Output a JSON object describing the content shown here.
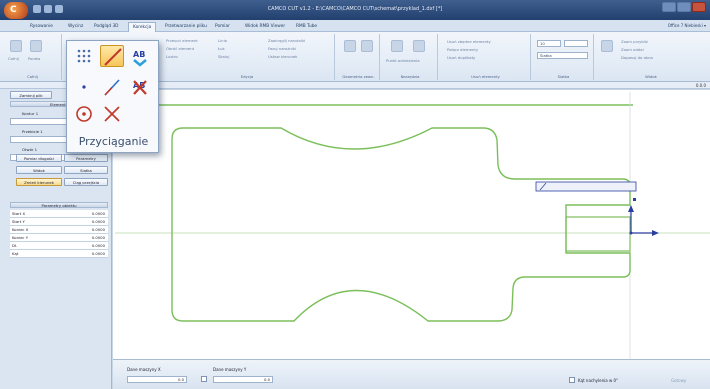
{
  "window": {
    "title": "CAMCO CUT v1.2 - E:\\CAMCO\\CAMCO CUT\\schemat\\przyklad_1.dxf [*]",
    "app_orb_label": "C"
  },
  "ribbon_tabs": [
    {
      "label": "Rysowanie"
    },
    {
      "label": "Wycinz"
    },
    {
      "label": "Podgląd 3D"
    },
    {
      "label": "Korekcja"
    },
    {
      "label": "Przetwarzanie pliku"
    },
    {
      "label": "Pomiar"
    },
    {
      "label": "Widok RMB Viewer"
    },
    {
      "label": "RMB Tube"
    }
  ],
  "active_tab": "Korekcja",
  "style_selector": "Office 7 Niebieski ▾",
  "ribbon": {
    "groups": [
      {
        "label": "Cofnij"
      },
      {
        "label": "Edycja"
      },
      {
        "label": "Geometria zewn."
      },
      {
        "label": "Narzędzia"
      },
      {
        "label": "Usuń elementy"
      },
      {
        "label": "Siatka"
      },
      {
        "label": "Widok"
      }
    ],
    "items": {
      "g1": [
        "Cofnij",
        "Ponów"
      ],
      "g2": [
        "Przesuń element",
        "Obróć element",
        "Lustro",
        "Linia",
        "Łuk",
        "Skaluj"
      ],
      "g3": [
        "Zaokrąglij narożniki",
        "Fazuj narożniki",
        "Ustaw kierunek",
        "Zmień start/koniec"
      ],
      "g4": [
        "Punkt odniesienia",
        "Przecięcia",
        "Wymiarowanie"
      ],
      "g5": [
        "Usuń zbędne elementy",
        "Połącz elementy",
        "Usuń duplikaty"
      ],
      "grid_combo_value": "10",
      "grid_combo2_value": "Siatka",
      "view": [
        "Zoom przybliż",
        "Zoom oddal",
        "Dopasuj do okna"
      ]
    }
  },
  "status_coords": "0.0.0",
  "left_panel": {
    "top_button": "Zamknij plik",
    "section_header": "Elementy",
    "label_1": "Kontur 1",
    "label_2": "Przebicie 1",
    "label_3": "Otwór 1",
    "button_grid": [
      {
        "label": "Pomiar długości",
        "selected": false
      },
      {
        "label": "Parametry",
        "selected": false
      },
      {
        "label": "Widok",
        "selected": false
      },
      {
        "label": "Siatka",
        "selected": false
      },
      {
        "label": "Zmień kierunek",
        "selected": true
      },
      {
        "label": "Ciąg przejścia",
        "selected": false
      }
    ],
    "properties_header": "Parametry obiektu",
    "properties": [
      {
        "key": "Start X",
        "value": "0.0000"
      },
      {
        "key": "Start Y",
        "value": "0.0000"
      },
      {
        "key": "Koniec X",
        "value": "0.0000"
      },
      {
        "key": "Koniec Y",
        "value": "0.0000"
      },
      {
        "key": "Dł.",
        "value": "0.0000"
      },
      {
        "key": "Kąt",
        "value": "0.0000"
      }
    ]
  },
  "snap_popup": {
    "label": "Przyciąganie",
    "tools": [
      {
        "icon": "grid-points-icon",
        "active": false
      },
      {
        "icon": "line-end-icon",
        "active": true
      },
      {
        "icon": "tangent-icon",
        "active": false
      },
      {
        "icon": "point-icon",
        "active": false
      },
      {
        "icon": "midpoint-line-icon",
        "active": false
      },
      {
        "icon": "intersection-icon",
        "active": false
      },
      {
        "icon": "center-icon",
        "active": false
      },
      {
        "icon": "cross-icon",
        "active": false
      }
    ]
  },
  "bottom_bar": {
    "field1_label": "Dane maszyny X",
    "field1_value": "0.0",
    "field2_label": "Dane maszyny Y",
    "field2_value": "0.0",
    "checkbox_label": "Kąt nachylenia w 0°",
    "corner_text": "Gotowy"
  },
  "colors": {
    "contour": "#7bbf5a",
    "axis_line": "#9fc98b",
    "axis_blue": "#2b3fa0",
    "accent": "#f7c65a"
  }
}
